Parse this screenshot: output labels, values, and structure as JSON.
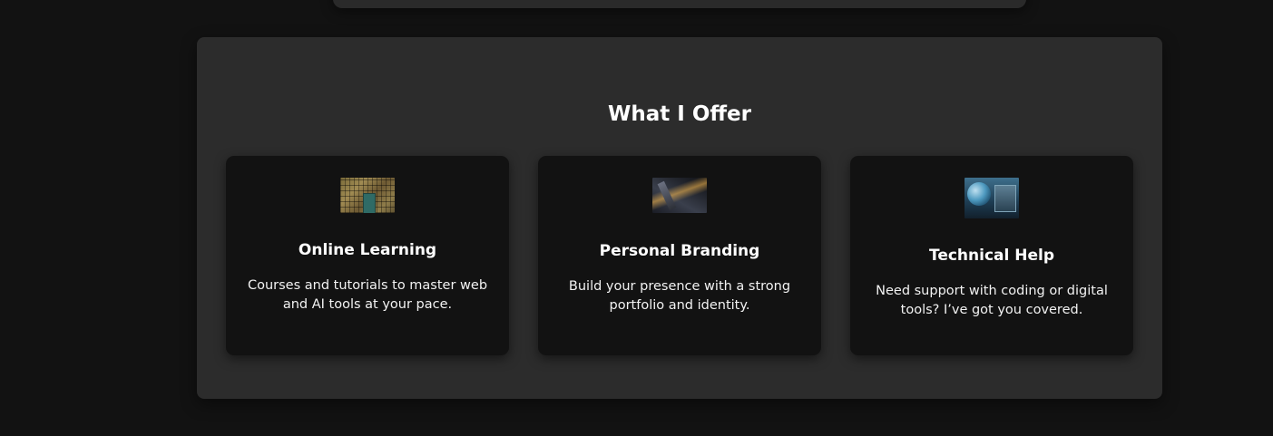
{
  "section": {
    "title": "What I Offer"
  },
  "offers": [
    {
      "image": "library-books-image",
      "title": "Online Learning",
      "description": "Courses and tutorials to master web and AI tools at your pace."
    },
    {
      "image": "tech-circuit-image",
      "title": "Personal Branding",
      "description": "Build your presence with a strong portfolio and identity."
    },
    {
      "image": "globe-tech-image",
      "title": "Technical Help",
      "description": "Need support with coding or digital tools? I’ve got you covered."
    }
  ],
  "colors": {
    "page_background": "#121212",
    "section_background": "#2c2c2c",
    "card_background": "#121212",
    "text": "#ffffff"
  }
}
